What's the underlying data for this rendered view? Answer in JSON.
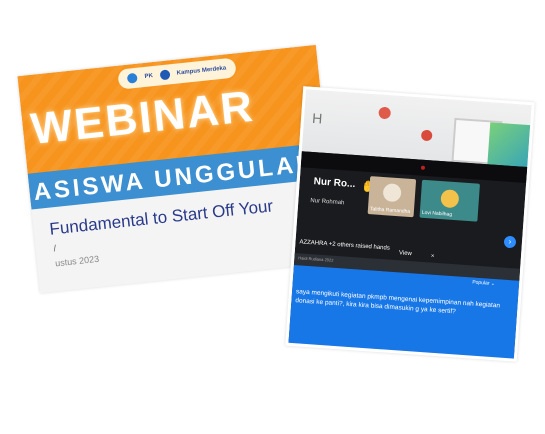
{
  "left_photo": {
    "logo_text": [
      "PK",
      "Kampus Merdeka"
    ],
    "title": "WEBINAR",
    "banner": "ASISWA UNGGULAN",
    "subtitle": "Fundamental to Start Off Your",
    "second_line": "/",
    "date": "ustus 2023",
    "colors": {
      "orange": "#f7941d",
      "blue": "#3c8fd0"
    }
  },
  "right_photo": {
    "wall_letter": "H",
    "participant_main": "Nur Ro...",
    "participant_main_sub": "Nur Rohmah",
    "participants": [
      {
        "label": "Talitha Ramandha"
      },
      {
        "label": "Lovi Nabilhag"
      }
    ],
    "arrow": "›",
    "raised_hands": "AZZAHRA +2 others raised hands",
    "view_label": "View",
    "close_label": "×",
    "chat_header": "Haidi Rudiana 2022",
    "popular_label": "Popular ⌄",
    "chat_message": "saya mengikuti kegiatan pkmpb mengenai kepemimpinan nah kegiatan donasi ke panti?, kira kira bisa dimasukin g ya ke sertif?",
    "colors": {
      "chat_blue": "#1877e6",
      "screen": "#1a1b1e"
    }
  }
}
